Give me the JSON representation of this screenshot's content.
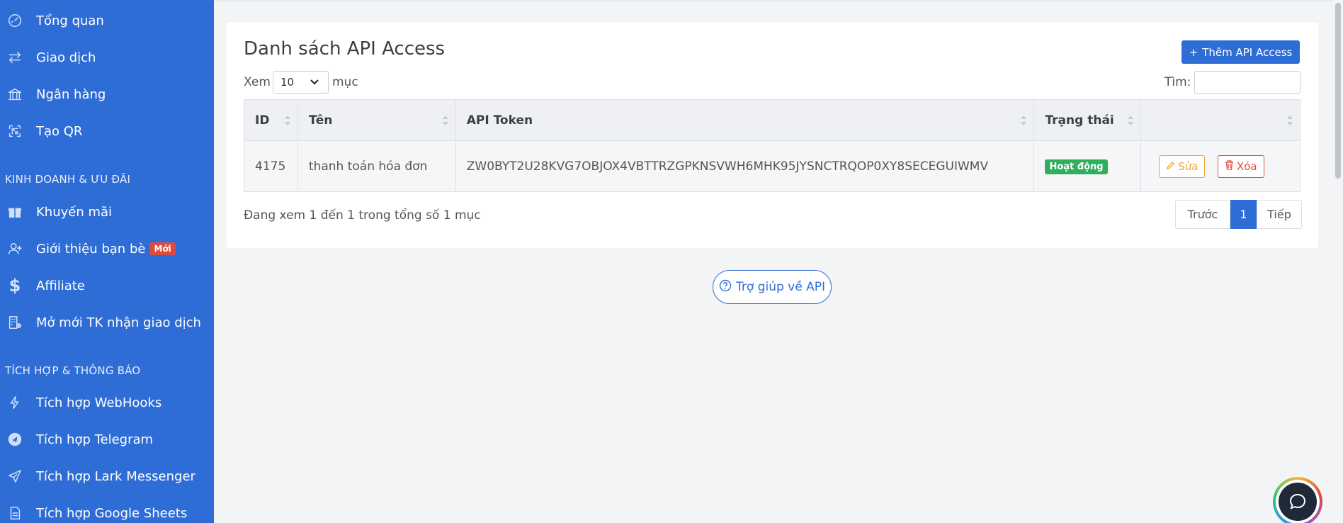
{
  "sidebar": {
    "items": [
      {
        "label": "Tổng quan",
        "icon": "dashboard-icon"
      },
      {
        "label": "Giao dịch",
        "icon": "transfer-icon"
      },
      {
        "label": "Ngân hàng",
        "icon": "bank-icon"
      },
      {
        "label": "Tạo QR",
        "icon": "qr-icon"
      },
      {
        "label": "Khuyến mãi",
        "icon": "gift-icon"
      },
      {
        "label": "Giới thiệu bạn bè",
        "icon": "user-plus-icon",
        "badge": "Mới"
      },
      {
        "label": "Affiliate",
        "icon": "dollar-icon"
      },
      {
        "label": "Mở mới TK nhận giao dịch",
        "icon": "building-plus-icon"
      },
      {
        "label": "Tích hợp WebHooks",
        "icon": "lightning-icon"
      },
      {
        "label": "Tích hợp Telegram",
        "icon": "telegram-icon"
      },
      {
        "label": "Tích hợp Lark Messenger",
        "icon": "send-icon"
      },
      {
        "label": "Tích hợp Google Sheets",
        "icon": "sheet-icon"
      }
    ],
    "sections": [
      "KINH DOANH & ƯU ĐÃI",
      "TÍCH HỢP & THÔNG BÁO"
    ]
  },
  "card": {
    "title": "Danh sách API Access",
    "add_button": "Thêm API Access",
    "length_prefix": "Xem",
    "length_value": "10",
    "length_suffix": "mục",
    "search_label": "Tìm:",
    "search_value": ""
  },
  "table": {
    "headers": [
      "ID",
      "Tên",
      "API Token",
      "Trạng thái",
      ""
    ],
    "rows": [
      {
        "id": "4175",
        "name": "thanh toán hóa đơn",
        "token": "ZW0BYT2U28KVG7OBJOX4VBTTRZGPKNSVWH6MHK95JYSNCTRQOP0XY8SECEGUIWMV",
        "status": "Hoạt động",
        "edit": "Sửa",
        "delete": "Xóa"
      }
    ]
  },
  "info": "Đang xem 1 đến 1 trong tổng số 1 mục",
  "pagination": {
    "prev": "Trước",
    "current": "1",
    "next": "Tiếp"
  },
  "help_button": "Trợ giúp về API",
  "colors": {
    "primary": "#2f6dd6",
    "success": "#2fae5c",
    "warning": "#f0a437",
    "danger": "#e04a3c"
  }
}
